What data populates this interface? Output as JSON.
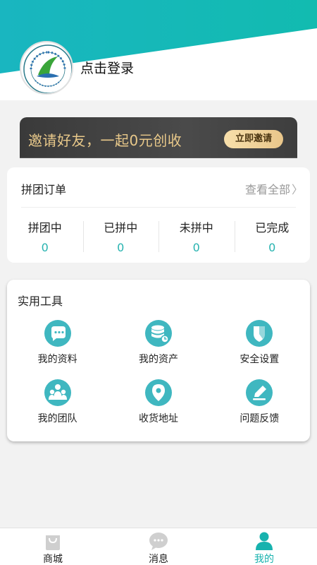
{
  "header": {
    "login_text": "点击登录",
    "logo_name": "school-logo",
    "accent_color": "#17b7b3"
  },
  "invite": {
    "slogan": "邀请好友，一起0元创收",
    "button_label": "立即邀请"
  },
  "orders": {
    "title": "拼团订单",
    "view_all": "查看全部",
    "stats": [
      {
        "label": "拼团中",
        "count": "0"
      },
      {
        "label": "已拼中",
        "count": "0"
      },
      {
        "label": "未拼中",
        "count": "0"
      },
      {
        "label": "已完成",
        "count": "0"
      }
    ]
  },
  "tools": {
    "title": "实用工具",
    "items": [
      {
        "label": "我的资料",
        "icon": "chat-bubble-icon"
      },
      {
        "label": "我的资产",
        "icon": "database-icon"
      },
      {
        "label": "安全设置",
        "icon": "shield-icon"
      },
      {
        "label": "我的团队",
        "icon": "team-icon"
      },
      {
        "label": "收货地址",
        "icon": "location-pin-icon"
      },
      {
        "label": "问题反馈",
        "icon": "edit-icon"
      }
    ]
  },
  "tabbar": {
    "items": [
      {
        "label": "商城",
        "icon": "shopping-bag-icon",
        "active": false
      },
      {
        "label": "消息",
        "icon": "message-icon",
        "active": false
      },
      {
        "label": "我的",
        "icon": "user-icon",
        "active": true
      }
    ]
  }
}
